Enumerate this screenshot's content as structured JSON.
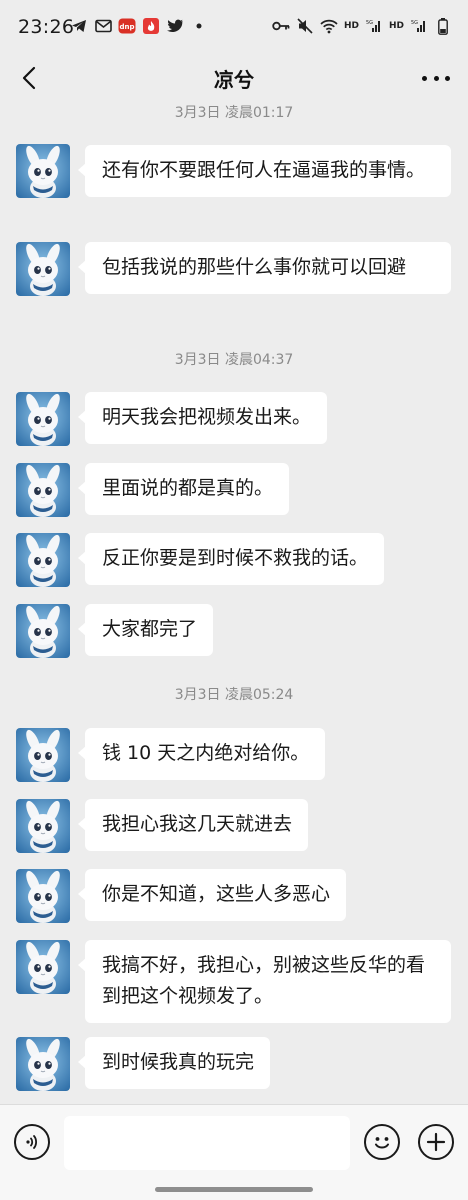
{
  "status_bar": {
    "time": "23:26",
    "left_icons": [
      "telegram-icon",
      "mail-icon",
      "app-badge-icon",
      "flame-icon",
      "twitter-icon",
      "dot-icon"
    ],
    "right_icons": [
      "key-icon",
      "mute-icon",
      "wifi-icon",
      "signal-icon",
      "signal-icon",
      "battery-icon"
    ],
    "network_label_1": "HD",
    "network_label_2": "HD"
  },
  "nav": {
    "title": "凉兮",
    "back_icon": "chevron-left-icon",
    "more_icon": "more-dots-icon"
  },
  "chat": {
    "timestamps": [
      {
        "text": "3月3日 凌晨01:17"
      },
      {
        "text": "3月3日 凌晨04:37"
      },
      {
        "text": "3月3日 凌晨05:24"
      }
    ],
    "messages": [
      {
        "text": "还有你不要跟任何人在逼逼我的事情。"
      },
      {
        "text": "包括我说的那些什么事你就可以回避"
      },
      {
        "text": "明天我会把视频发出来。"
      },
      {
        "text": "里面说的都是真的。"
      },
      {
        "text": "反正你要是到时候不救我的话。"
      },
      {
        "text": "大家都完了"
      },
      {
        "text": "钱 10 天之内绝对给你。"
      },
      {
        "text": "我担心我这几天就进去"
      },
      {
        "text": "你是不知道，这些人多恶心"
      },
      {
        "text": "我搞不好，我担心，别被这些反华的看到把这个视频发了。"
      },
      {
        "text": "到时候我真的玩完"
      }
    ]
  },
  "input_bar": {
    "placeholder": "",
    "voice_icon": "voice-icon",
    "emoji_icon": "emoji-icon",
    "plus_icon": "plus-icon"
  }
}
